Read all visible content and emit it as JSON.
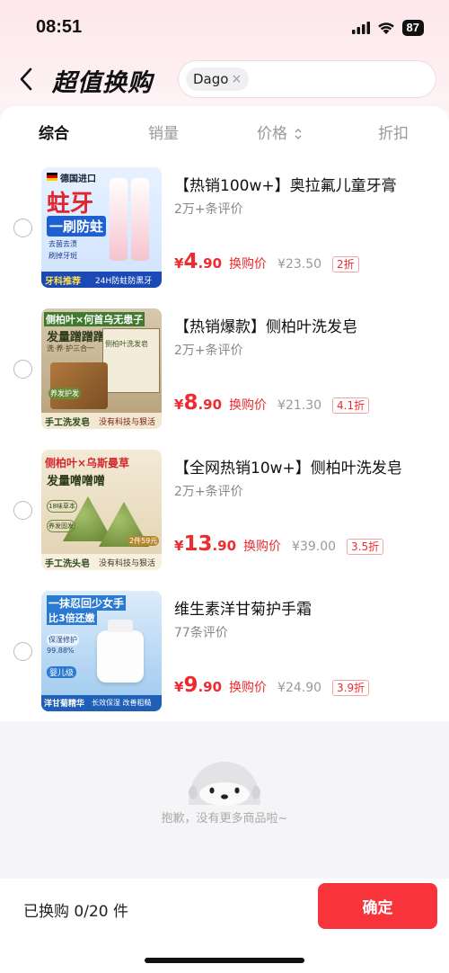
{
  "status_bar": {
    "time": "08:51",
    "battery": "87",
    "icons": [
      "signal-icon",
      "wifi-icon",
      "battery-icon"
    ]
  },
  "nav": {
    "back_icon": "chevron-left-icon",
    "title": "超值换购"
  },
  "search": {
    "tag": "Dago",
    "clear_symbol": "×"
  },
  "sort": {
    "items": [
      "综合",
      "销量",
      "价格",
      "折扣"
    ],
    "active": "综合",
    "price_icon": "sort-updown-icon"
  },
  "products": [
    {
      "title": "【热销100w+】奥拉氟儿童牙膏",
      "reviews": "2万+条评价",
      "currency": "¥",
      "price_int": "4",
      "price_dec": ".90",
      "price_label": "换购价",
      "original_price": "¥23.50",
      "discount": "2折",
      "thumb": {
        "flag_text": "德国进口",
        "big1": "蛀牙",
        "big2": "一刷防蛀",
        "f1": "去菌去渍",
        "f2": "刷掉牙斑",
        "bottom_left": "牙科推荐",
        "bottom_right": "24H防蛀防黑牙"
      }
    },
    {
      "title": "【热销爆款】侧柏叶洗发皂",
      "reviews": "2万+条评价",
      "currency": "¥",
      "price_int": "8",
      "price_dec": ".90",
      "price_label": "换购价",
      "original_price": "¥21.30",
      "discount": "4.1折",
      "thumb": {
        "top": "侧柏叶×何首乌无患子",
        "line2": "发量蹭蹭蹭",
        "line3": "洗·养·护三合一",
        "box": "侧柏叶洗发皂",
        "badge": "养发护发",
        "bottom_left": "手工洗发皂",
        "bottom_right": "没有科技与狠活"
      }
    },
    {
      "title": "【全网热销10w+】侧柏叶洗发皂",
      "reviews": "2万+条评价",
      "currency": "¥",
      "price_int": "13",
      "price_dec": ".90",
      "price_label": "换购价",
      "original_price": "¥39.00",
      "discount": "3.5折",
      "thumb": {
        "top": "侧柏叶×乌斯曼草",
        "line2": "发量噌噌噌",
        "badge1": "18味草本",
        "badge2": "养发固发",
        "price_tag": "2件59元",
        "bottom_left": "手工洗头皂",
        "bottom_right": "没有科技与狠活"
      }
    },
    {
      "title": "维生素洋甘菊护手霜",
      "reviews": "77条评价",
      "currency": "¥",
      "price_int": "9",
      "price_dec": ".90",
      "price_label": "换购价",
      "original_price": "¥24.90",
      "discount": "3.9折",
      "thumb": {
        "top": "一抹忍回少女手",
        "line2": "比3倍还嫩",
        "badge1": "保湿修护",
        "badge2": "99.88%",
        "infant": "婴儿级",
        "bottom_left": "洋甘菊精华",
        "bottom_right": "长效保湿 改善粗糙"
      }
    }
  ],
  "empty": {
    "text": "抱歉，没有更多商品啦~"
  },
  "footer": {
    "count_label": "已换购 0/20 件",
    "confirm_label": "确定"
  },
  "colors": {
    "accent_red": "#ee2b2f",
    "button_red": "#f7343c"
  }
}
